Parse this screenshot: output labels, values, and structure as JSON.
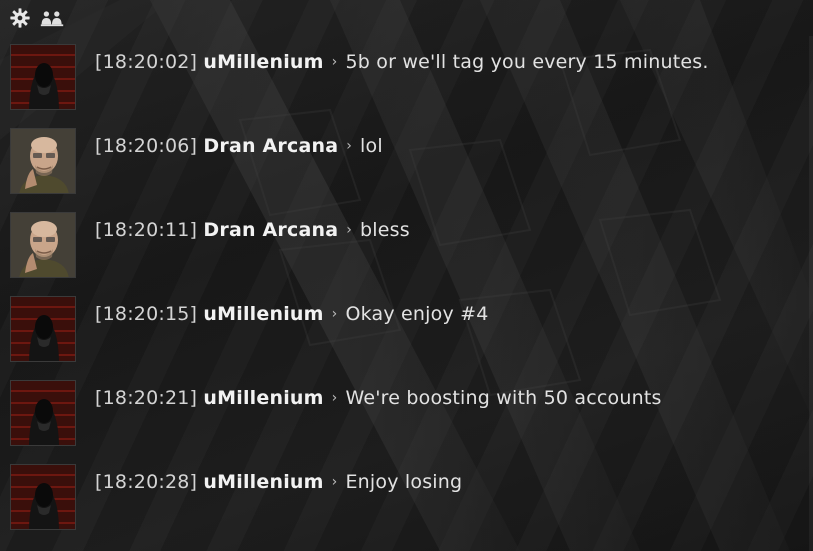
{
  "toolbar": {
    "settings_icon": "gear-icon",
    "members_icon": "people-icon"
  },
  "messages": [
    {
      "timestamp": "[18:20:02]",
      "author": "uMillenium",
      "separator": "›",
      "text": "5b or we'll tag you every 15 minutes.",
      "avatar": "dark-hooded"
    },
    {
      "timestamp": "[18:20:06]",
      "author": "Dran Arcana",
      "separator": "›",
      "text": "lol",
      "avatar": "bald-old-man"
    },
    {
      "timestamp": "[18:20:11]",
      "author": "Dran Arcana",
      "separator": "›",
      "text": "bless",
      "avatar": "bald-old-man"
    },
    {
      "timestamp": "[18:20:15]",
      "author": "uMillenium",
      "separator": "›",
      "text": "Okay enjoy #4",
      "avatar": "dark-hooded"
    },
    {
      "timestamp": "[18:20:21]",
      "author": "uMillenium",
      "separator": "›",
      "text": "We're boosting with 50 accounts",
      "avatar": "dark-hooded"
    },
    {
      "timestamp": "[18:20:28]",
      "author": "uMillenium",
      "separator": "›",
      "text": "Enjoy losing",
      "avatar": "dark-hooded"
    }
  ],
  "colors": {
    "accent_red": "#8a1a12",
    "text": "#e2e2e2"
  }
}
